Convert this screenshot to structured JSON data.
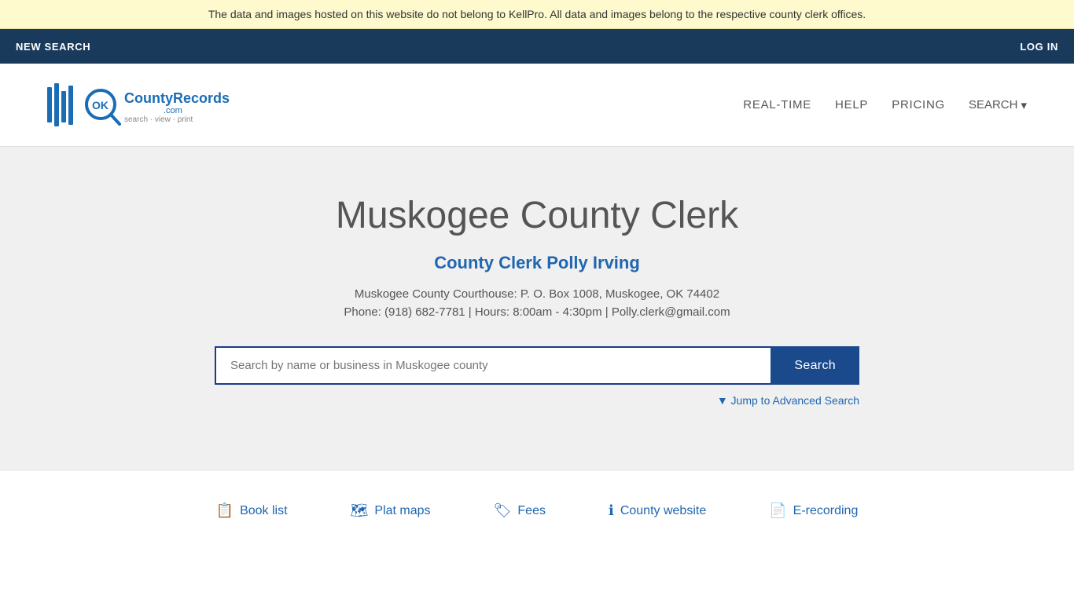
{
  "banner": {
    "text": "The data and images hosted on this website do not belong to KellPro. All data and images belong to the respective county clerk offices."
  },
  "topNav": {
    "newSearch": "NEW SEARCH",
    "logIn": "LOG IN"
  },
  "header": {
    "logoAlt": "OKCountyRecords.com - search · view · print",
    "nav": {
      "realTime": "REAL-TIME",
      "help": "HELP",
      "pricing": "PRICING",
      "search": "SEARCH"
    }
  },
  "hero": {
    "title": "Muskogee County Clerk",
    "clerkName": "County Clerk Polly Irving",
    "address": "Muskogee County Courthouse: P. O. Box 1008, Muskogee, OK 74402",
    "phone": "Phone: (918) 682-7781 | Hours: 8:00am - 4:30pm | Polly.clerk@gmail.com",
    "searchPlaceholder": "Search by name or business in Muskogee county",
    "searchButton": "Search",
    "advancedSearch": "▼ Jump to Advanced Search"
  },
  "footer": {
    "links": [
      {
        "label": "Book list",
        "icon": "📋"
      },
      {
        "label": "Plat maps",
        "icon": "🗺"
      },
      {
        "label": "Fees",
        "icon": "🏷"
      },
      {
        "label": "County website",
        "icon": "ℹ"
      },
      {
        "label": "E-recording",
        "icon": "📄"
      }
    ]
  }
}
